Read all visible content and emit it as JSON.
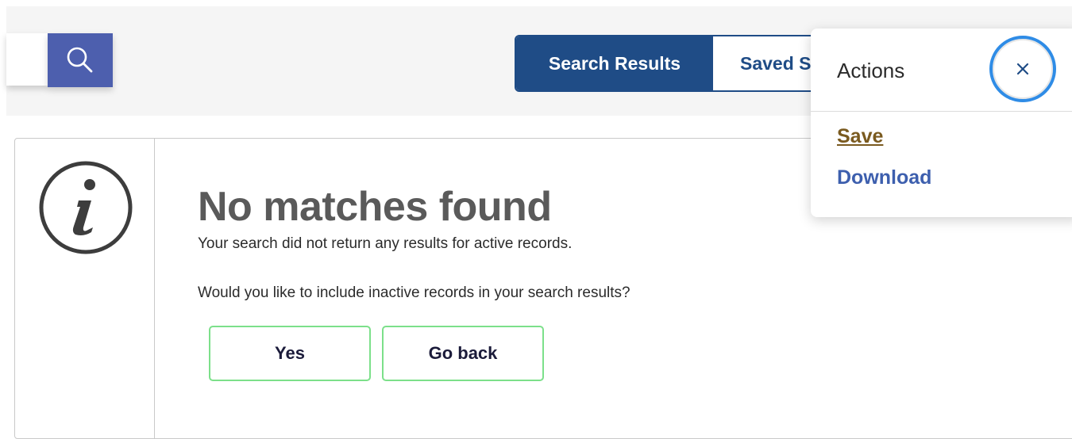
{
  "search": {
    "input_value": "",
    "button_icon": "search-icon"
  },
  "tabs": [
    {
      "label": "Search Results",
      "active": true
    },
    {
      "label": "Saved S",
      "active": false
    }
  ],
  "alert": {
    "icon": "info-icon",
    "title": "No matches found",
    "message": "Your search did not return any results for active records.",
    "question": "Would you like to include inactive records in your search results?",
    "yes_label": "Yes",
    "back_label": "Go back"
  },
  "actions_menu": {
    "title": "Actions",
    "close_icon": "close-icon",
    "items": [
      {
        "label": "Save"
      },
      {
        "label": "Download"
      }
    ]
  },
  "colors": {
    "primary_navy": "#1f4c86",
    "search_button": "#4d5fae",
    "button_border_green": "#7ce08a",
    "focus_ring": "#2f8ce6",
    "save_link": "#7a5a1f",
    "download_link": "#3d5fae"
  }
}
